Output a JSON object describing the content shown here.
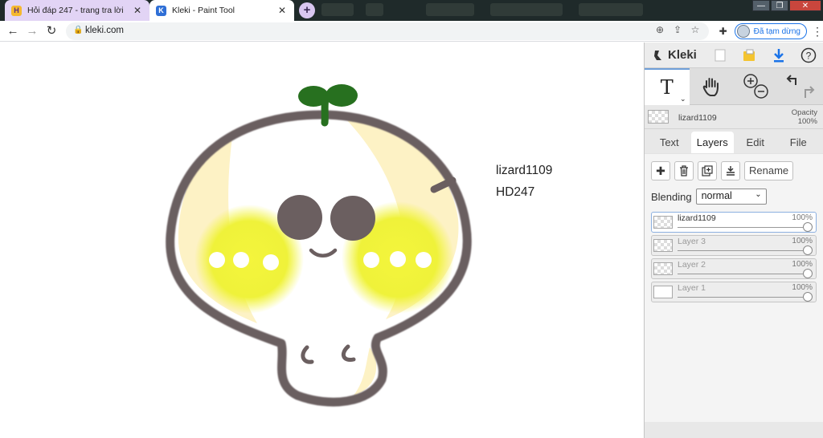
{
  "browser": {
    "tabs": [
      {
        "label": "Hỏi đáp 247 - trang tra lời",
        "favicon": "hoidap-logo-icon",
        "active": false
      },
      {
        "label": "Kleki - Paint Tool",
        "favicon": "kleki-logo-icon",
        "active": true
      }
    ],
    "new_tab_label": "+",
    "url": "kleki.com",
    "profile_label": "Đã tạm dừng",
    "colors": {
      "titlebar": "#1f2a2a",
      "inactive_tab": "#e2d4f5",
      "profile_accent": "#1a73e8"
    }
  },
  "canvas": {
    "text_lines": [
      "lizard1109",
      "HD247"
    ],
    "colors": {
      "outline": "#6b5f60",
      "leaf": "#27701f",
      "cheek": "#f2f23a",
      "cap": "#fdf2c5",
      "eye": "#6b5f60"
    }
  },
  "kleki": {
    "logo_text": "Kleki",
    "tools": {
      "text_tool_glyph": "T",
      "text_tool_sub": "⌄"
    },
    "current_layer": {
      "name": "lizard1109",
      "opacity_label": "Opacity",
      "opacity_value": "100%"
    },
    "tabs": [
      "Text",
      "Layers",
      "Edit",
      "File"
    ],
    "active_tab": "Layers",
    "rename_label": "Rename",
    "blending_label": "Blending",
    "blending_value": "normal",
    "layers": [
      {
        "name": "lizard1109",
        "opacity": "100%",
        "selected": true
      },
      {
        "name": "Layer 3",
        "opacity": "100%",
        "selected": false
      },
      {
        "name": "Layer 2",
        "opacity": "100%",
        "selected": false
      },
      {
        "name": "Layer 1",
        "opacity": "100%",
        "selected": false
      }
    ]
  }
}
